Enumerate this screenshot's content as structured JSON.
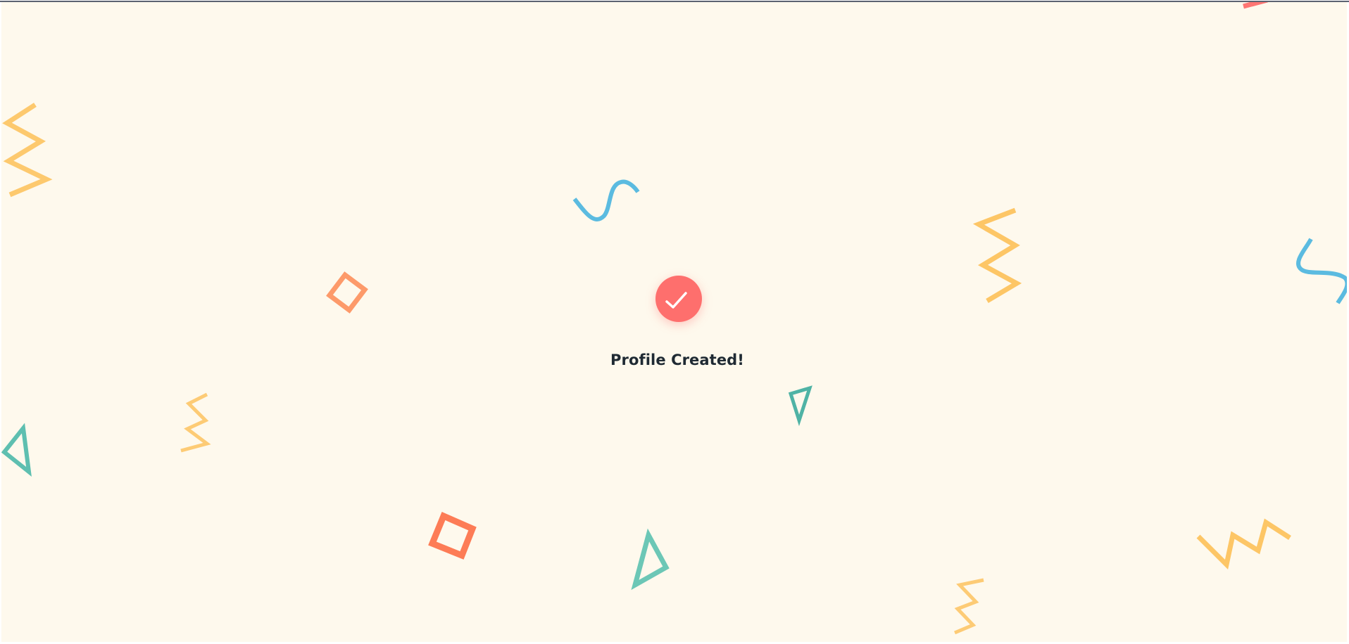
{
  "confirmation": {
    "title": "Profile Created!",
    "icon": "check-icon"
  },
  "colors": {
    "background": "#fef9ed",
    "accent": "#fe6f6d",
    "text": "#1f2a33",
    "confetti_yellow": "#fdc35f",
    "confetti_blue": "#5bbbe0",
    "confetti_orange": "#fd7c56",
    "confetti_teal": "#5ebfb0"
  }
}
